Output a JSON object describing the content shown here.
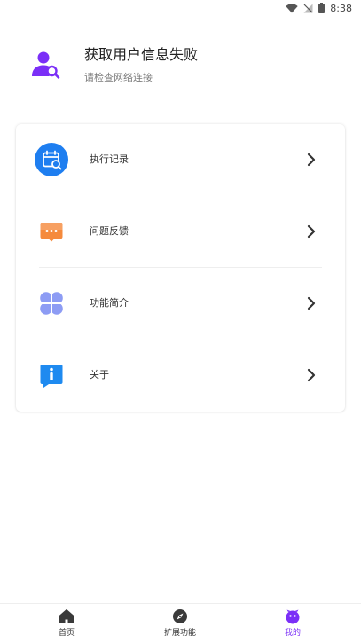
{
  "status_bar": {
    "time": "8:38"
  },
  "profile": {
    "title": "获取用户信息失败",
    "subtitle": "请检查网络连接"
  },
  "menu": {
    "items": [
      {
        "label": "执行记录",
        "icon": "calendar-search-icon"
      },
      {
        "label": "问题反馈",
        "icon": "chat-bubble-icon"
      },
      {
        "label": "功能简介",
        "icon": "four-petal-icon"
      },
      {
        "label": "关于",
        "icon": "info-bubble-icon"
      }
    ]
  },
  "bottom_nav": {
    "items": [
      {
        "label": "首页",
        "icon": "home-icon",
        "active": false
      },
      {
        "label": "扩展功能",
        "icon": "compass-icon",
        "active": false
      },
      {
        "label": "我的",
        "icon": "mascot-icon",
        "active": true
      }
    ]
  },
  "colors": {
    "accent": "#7b2ff7",
    "blue": "#1e7ef0",
    "orange": "#f58a3c",
    "lavender": "#8d9cf4",
    "text": "#333333"
  }
}
